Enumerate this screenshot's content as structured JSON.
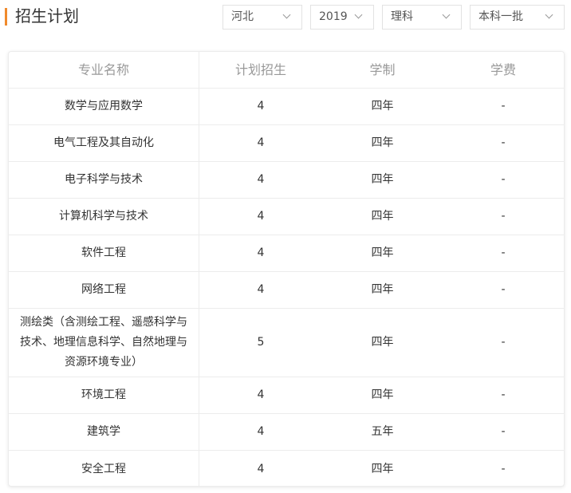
{
  "header": {
    "title": "招生计划"
  },
  "filters": {
    "province": "河北",
    "year": "2019",
    "subject": "理科",
    "batch": "本科一批"
  },
  "table": {
    "columns": [
      "专业名称",
      "计划招生",
      "学制",
      "学费"
    ],
    "rows": [
      {
        "major": "数学与应用数学",
        "plan": "4",
        "duration": "四年",
        "fee": "-"
      },
      {
        "major": "电气工程及其自动化",
        "plan": "4",
        "duration": "四年",
        "fee": "-"
      },
      {
        "major": "电子科学与技术",
        "plan": "4",
        "duration": "四年",
        "fee": "-"
      },
      {
        "major": "计算机科学与技术",
        "plan": "4",
        "duration": "四年",
        "fee": "-"
      },
      {
        "major": "软件工程",
        "plan": "4",
        "duration": "四年",
        "fee": "-"
      },
      {
        "major": "网络工程",
        "plan": "4",
        "duration": "四年",
        "fee": "-"
      },
      {
        "major": "测绘类（含测绘工程、遥感科学与技术、地理信息科学、自然地理与资源环境专业）",
        "plan": "5",
        "duration": "四年",
        "fee": "-"
      },
      {
        "major": "环境工程",
        "plan": "4",
        "duration": "四年",
        "fee": "-"
      },
      {
        "major": "建筑学",
        "plan": "4",
        "duration": "五年",
        "fee": "-"
      },
      {
        "major": "安全工程",
        "plan": "4",
        "duration": "四年",
        "fee": "-"
      }
    ]
  },
  "colors": {
    "accent": "#f08a2c",
    "border": "#ececec",
    "header_text": "#999999"
  }
}
